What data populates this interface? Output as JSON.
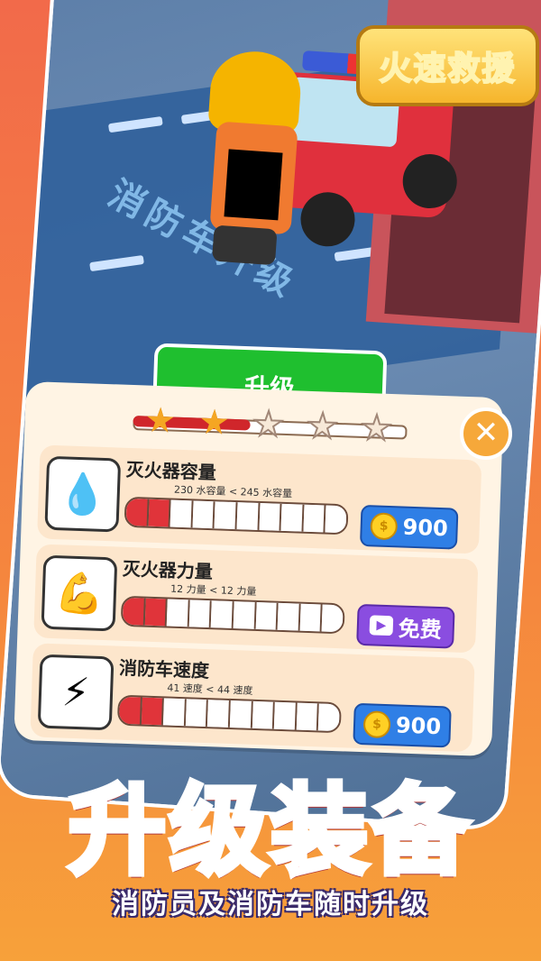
{
  "game": {
    "title": "火速救援",
    "floor_text": "消防车升级"
  },
  "panel": {
    "tab_label": "升级",
    "stars": [
      true,
      true,
      false,
      false,
      false
    ],
    "close_symbol": "✕",
    "items": [
      {
        "name": "灭火器容量",
        "icon": "water-drop-icon",
        "glyph": "💧",
        "stats": "230 水容量 < 245 水容量",
        "level_filled": 2,
        "level_total": 10,
        "button_type": "coin",
        "button_label": "900"
      },
      {
        "name": "灭火器力量",
        "icon": "muscle-arm-icon",
        "glyph": "💪",
        "stats": "12 力量 < 12 力量",
        "level_filled": 2,
        "level_total": 10,
        "button_type": "video",
        "button_label": "免费"
      },
      {
        "name": "消防车速度",
        "icon": "lightning-icon",
        "glyph": "⚡",
        "stats": "41 速度 < 44 速度",
        "level_filled": 2,
        "level_total": 10,
        "button_type": "coin",
        "button_label": "900"
      }
    ]
  },
  "promo": {
    "headline": "升级装备",
    "subline": "消防员及消防车随时升级"
  },
  "colors": {
    "accent_red": "#e0343a",
    "coin_button": "#2f7fe6",
    "free_button": "#8a4de0",
    "tab_green": "#1fbf2f"
  }
}
